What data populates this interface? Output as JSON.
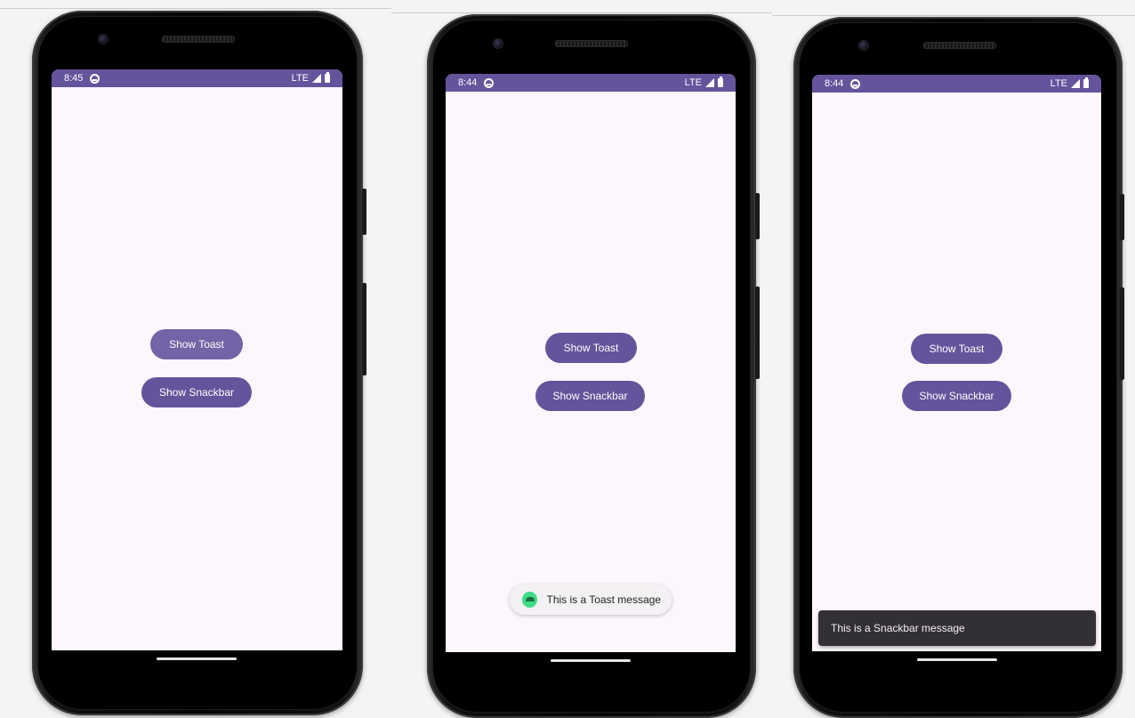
{
  "colors": {
    "primary": "#65539c",
    "screen_background": "#fdf7fd",
    "snackbar_background": "#322f35",
    "toast_background": "#f4f1f4",
    "android_icon": "#3ddc84"
  },
  "phones": [
    {
      "status": {
        "time": "8:45",
        "network": "LTE"
      },
      "buttons": {
        "toast_label": "Show Toast",
        "snackbar_label": "Show Snackbar"
      }
    },
    {
      "status": {
        "time": "8:44",
        "network": "LTE"
      },
      "buttons": {
        "toast_label": "Show Toast",
        "snackbar_label": "Show Snackbar"
      },
      "toast": {
        "message": "This is a Toast message",
        "icon": "android-icon"
      }
    },
    {
      "status": {
        "time": "8:44",
        "network": "LTE"
      },
      "buttons": {
        "toast_label": "Show Toast",
        "snackbar_label": "Show Snackbar"
      },
      "snackbar": {
        "message": "This is a Snackbar message"
      }
    }
  ]
}
